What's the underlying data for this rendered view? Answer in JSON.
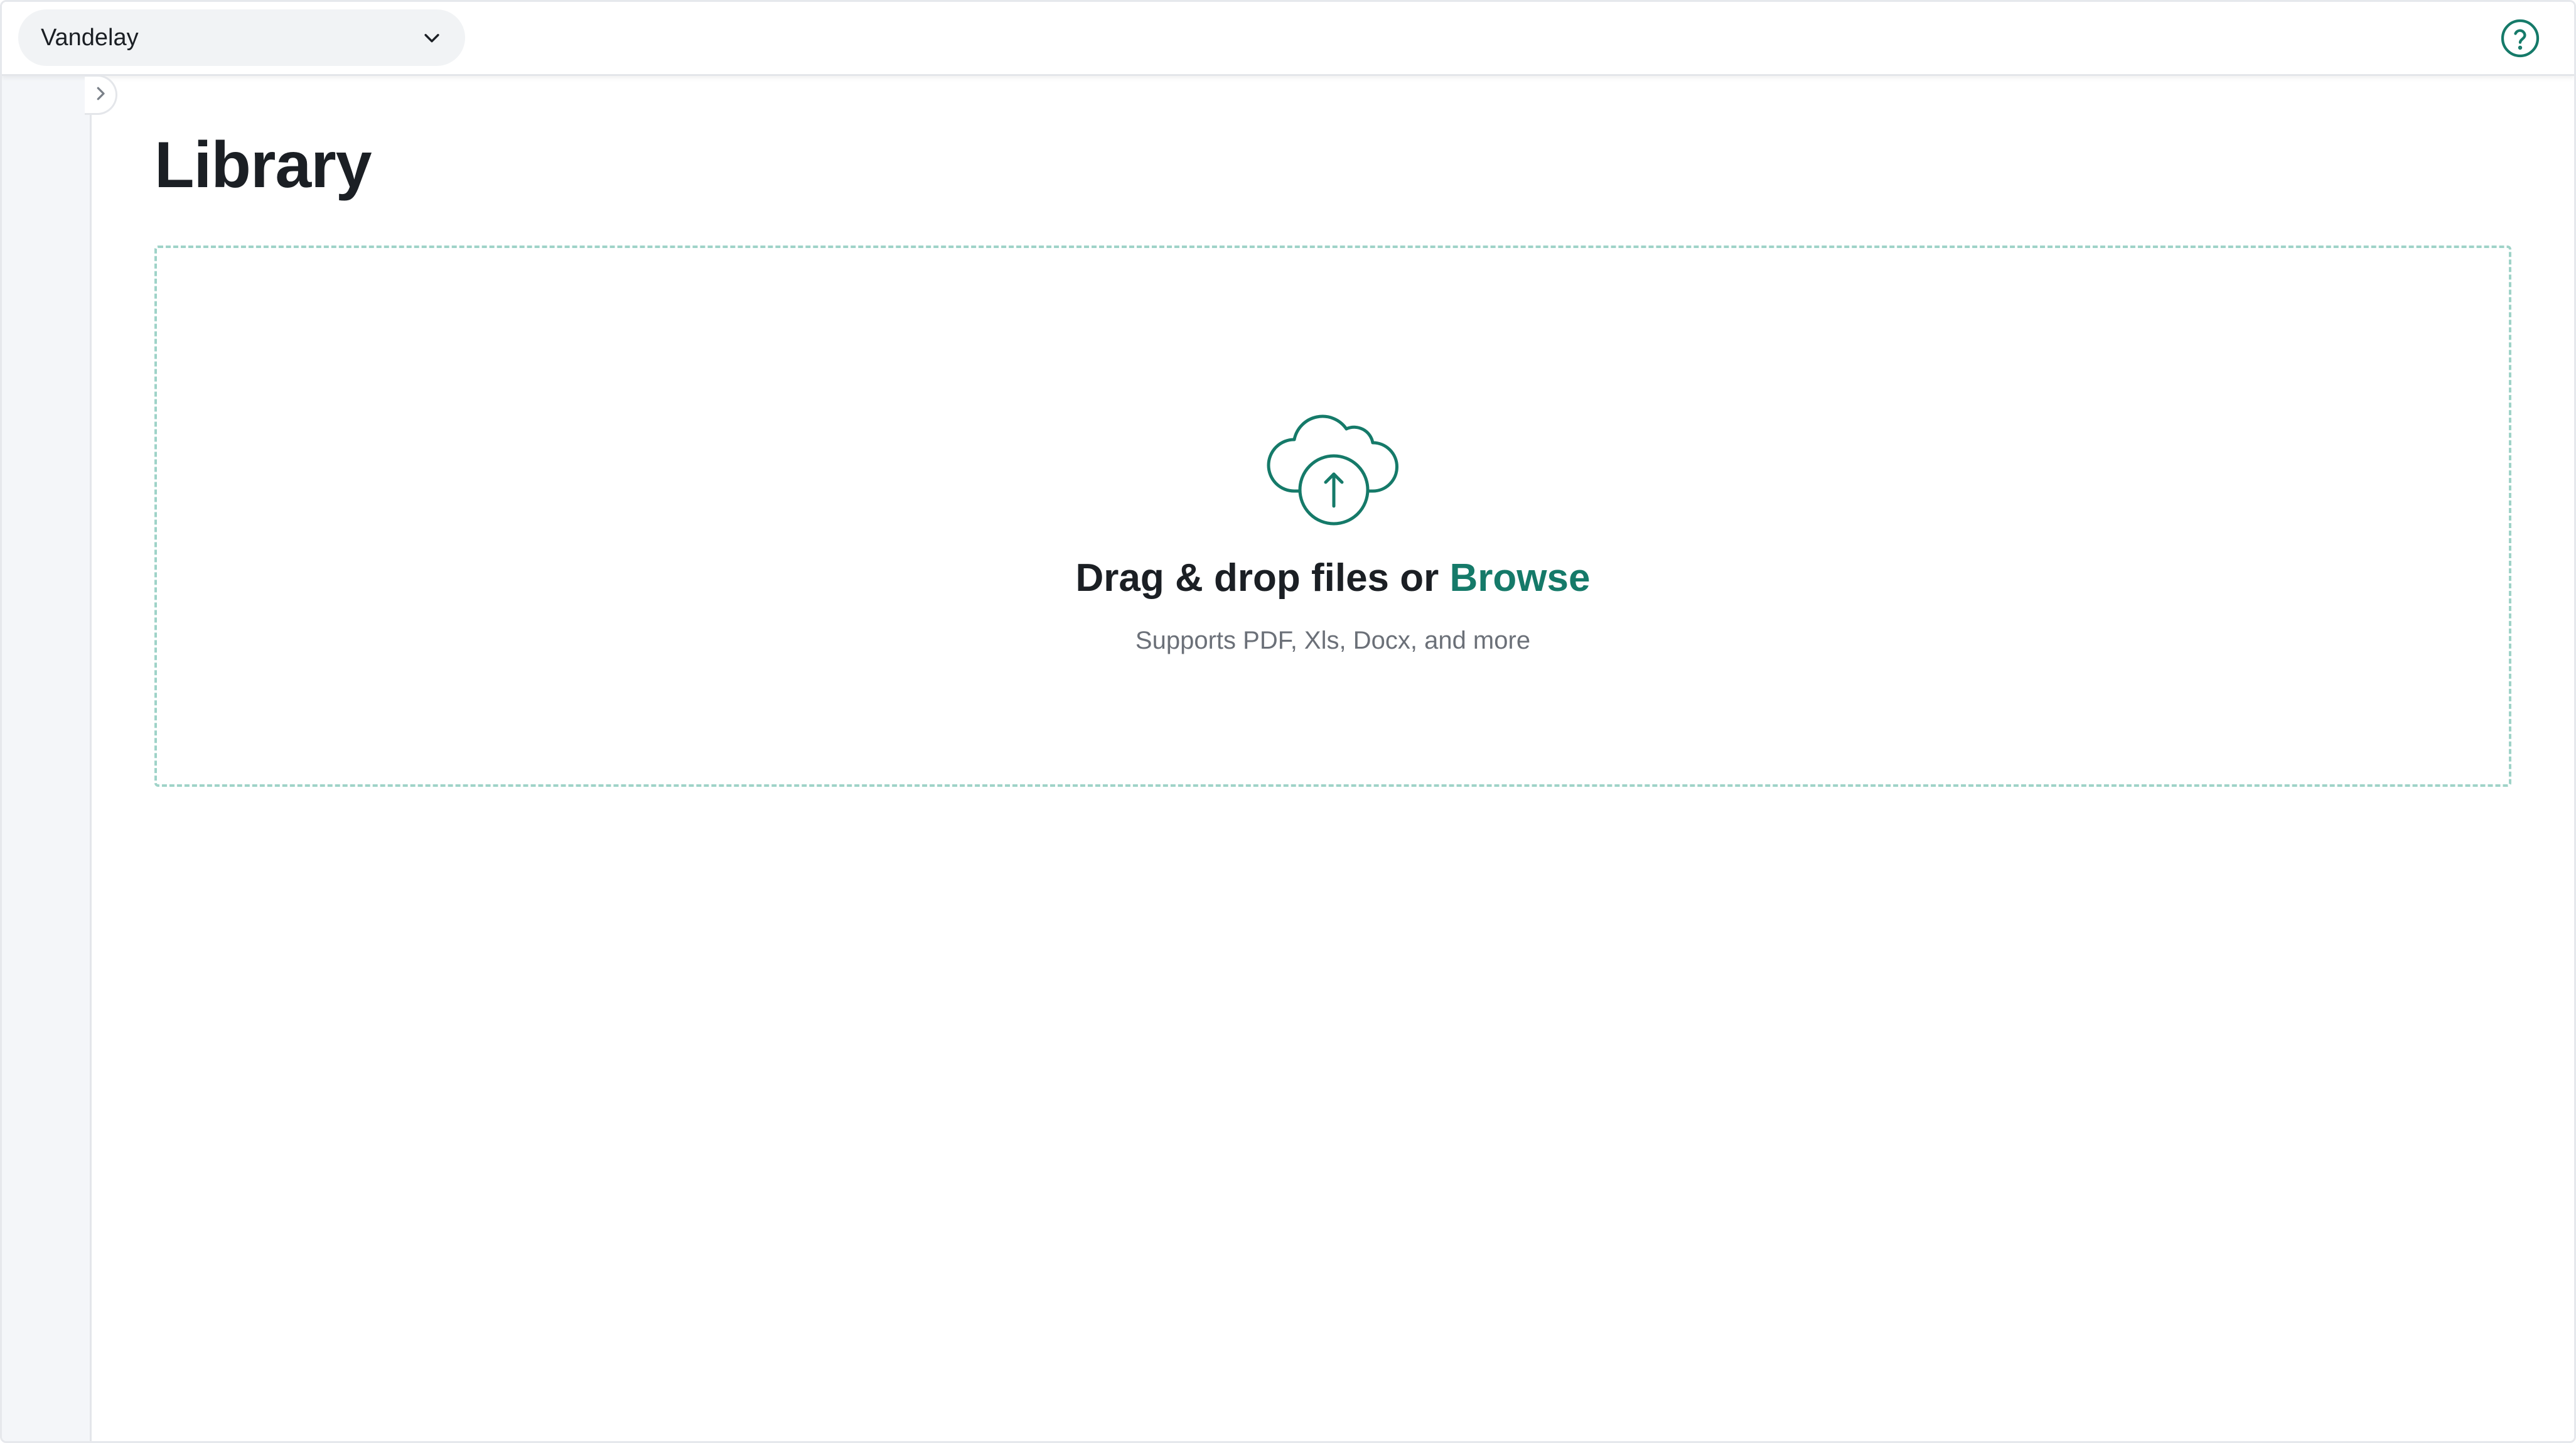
{
  "colors": {
    "accent": "#157a69",
    "dropzone_border": "#9fd3c8",
    "sidebar_bg": "#f4f6f9",
    "text_primary": "#1b1f24",
    "text_secondary": "#6b7078"
  },
  "topbar": {
    "workspace_selected": "Vandelay",
    "workspace_icon": "chevron-down-icon",
    "help_icon": "help-circle-icon"
  },
  "sidebar": {
    "toggle_icon": "chevron-right-icon",
    "items": [
      {
        "icon": "brand-logo-icon",
        "active": false
      },
      {
        "icon": "home-icon",
        "active": true
      },
      {
        "icon": "send-icon",
        "active": false
      },
      {
        "icon": "check-circle-icon",
        "active": false
      },
      {
        "icon": "briefcase-icon",
        "active": false
      },
      {
        "icon": "help-circle-icon",
        "active": false
      }
    ]
  },
  "main": {
    "title": "Library",
    "dropzone": {
      "icon": "cloud-upload-icon",
      "prompt": "Drag & drop files or",
      "browse_label": "Browse",
      "supported": "Supports PDF, Xls, Docx, and more"
    }
  }
}
